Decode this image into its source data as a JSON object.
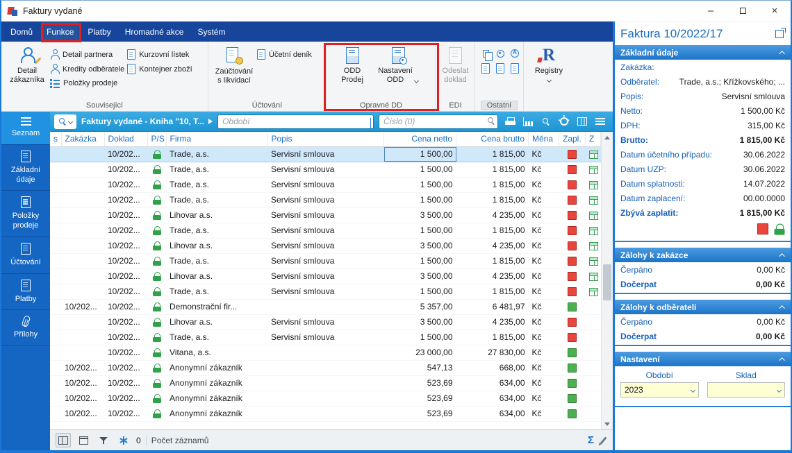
{
  "window": {
    "title": "Faktury vydané"
  },
  "icons": {
    "sum_glyph": "Σ",
    "registry_glyph": "R"
  },
  "ribbon": {
    "tabs": [
      {
        "id": "domu",
        "label": "Domů",
        "active": false
      },
      {
        "id": "funkce",
        "label": "Funkce",
        "active": true
      },
      {
        "id": "platby",
        "label": "Platby",
        "active": false
      },
      {
        "id": "hromadne-akce",
        "label": "Hromadné akce",
        "active": false
      },
      {
        "id": "system",
        "label": "Systém",
        "active": false
      }
    ],
    "detail_customer_label": "Detail\nzákazníka",
    "groups": {
      "related": {
        "title": "Související",
        "items": [
          {
            "id": "detail-partnera",
            "label": "Detail partnera",
            "icon": "person-card"
          },
          {
            "id": "kredity-odberatele",
            "label": "Kredity odběratele",
            "icon": "person-key"
          },
          {
            "id": "polozky-prodeje",
            "label": "Položky prodeje",
            "icon": "list"
          },
          {
            "id": "kurzovni-listek",
            "label": "Kurzovní lístek",
            "icon": "doc"
          },
          {
            "id": "kontejner-zbozi",
            "label": "Kontejner zboží",
            "icon": "doc"
          }
        ]
      },
      "accounting": {
        "title": "Účtování",
        "posting_label": "Zaúčtování\ns likvidací",
        "journal_label": "Účetní deník"
      },
      "corrective": {
        "title": "Opravné DD",
        "odd_sale_label": "ODD\nProdej",
        "odd_settings_label": "Nastavení\nODD"
      },
      "edi": {
        "title": "EDI",
        "send_label": "Odeslat\ndoklad"
      },
      "other": {
        "title": "Ostatní"
      },
      "registry": {
        "label": "Registry"
      }
    }
  },
  "sidebar": [
    {
      "id": "seznam",
      "label": "Seznam",
      "icon": "menu",
      "active": true
    },
    {
      "id": "zakladni-udaje",
      "label": "Základní údaje",
      "icon": "doc",
      "active": false
    },
    {
      "id": "polozky-prodeje",
      "label": "Položky prodeje",
      "icon": "doc",
      "active": false
    },
    {
      "id": "uctovani",
      "label": "Účtování",
      "icon": "doc",
      "active": false
    },
    {
      "id": "platby",
      "label": "Platby",
      "icon": "doc",
      "active": false
    },
    {
      "id": "prilohy",
      "label": "Přílohy",
      "icon": "clip",
      "active": false
    }
  ],
  "toolbar": {
    "book_label": "Faktury vydané - Kniha \"10, T...",
    "period_placeholder": "Období",
    "search_placeholder": "Číslo (0)"
  },
  "table": {
    "columns": [
      "s",
      "Zakázka",
      "Doklad",
      "P/S",
      "Firma",
      "Popis",
      "Cena netto",
      "Cena brutto",
      "Měna",
      "Zapl.",
      "Z"
    ],
    "rows": [
      {
        "zakazka": "",
        "doklad": "10/202...",
        "lock": true,
        "firma": "Trade, a.s.",
        "popis": "Servisní smlouva",
        "netto": "1 500,00",
        "brutto": "1 815,00",
        "mena": "Kč",
        "zapl": "red",
        "z": true,
        "selected": true
      },
      {
        "zakazka": "",
        "doklad": "10/202...",
        "lock": true,
        "firma": "Trade, a.s.",
        "popis": "Servisní smlouva",
        "netto": "1 500,00",
        "brutto": "1 815,00",
        "mena": "Kč",
        "zapl": "red",
        "z": true,
        "selected": false
      },
      {
        "zakazka": "",
        "doklad": "10/202...",
        "lock": true,
        "firma": "Trade, a.s.",
        "popis": "Servisní smlouva",
        "netto": "1 500,00",
        "brutto": "1 815,00",
        "mena": "Kč",
        "zapl": "red",
        "z": true,
        "selected": false
      },
      {
        "zakazka": "",
        "doklad": "10/202...",
        "lock": true,
        "firma": "Trade, a.s.",
        "popis": "Servisní smlouva",
        "netto": "1 500,00",
        "brutto": "1 815,00",
        "mena": "Kč",
        "zapl": "red",
        "z": true,
        "selected": false
      },
      {
        "zakazka": "",
        "doklad": "10/202...",
        "lock": true,
        "firma": "Lihovar a.s.",
        "popis": "Servisní smlouva",
        "netto": "3 500,00",
        "brutto": "4 235,00",
        "mena": "Kč",
        "zapl": "red",
        "z": true,
        "selected": false
      },
      {
        "zakazka": "",
        "doklad": "10/202...",
        "lock": true,
        "firma": "Trade, a.s.",
        "popis": "Servisní smlouva",
        "netto": "1 500,00",
        "brutto": "1 815,00",
        "mena": "Kč",
        "zapl": "red",
        "z": true,
        "selected": false
      },
      {
        "zakazka": "",
        "doklad": "10/202...",
        "lock": true,
        "firma": "Lihovar a.s.",
        "popis": "Servisní smlouva",
        "netto": "3 500,00",
        "brutto": "4 235,00",
        "mena": "Kč",
        "zapl": "red",
        "z": true,
        "selected": false
      },
      {
        "zakazka": "",
        "doklad": "10/202...",
        "lock": true,
        "firma": "Trade, a.s.",
        "popis": "Servisní smlouva",
        "netto": "1 500,00",
        "brutto": "1 815,00",
        "mena": "Kč",
        "zapl": "red",
        "z": true,
        "selected": false
      },
      {
        "zakazka": "",
        "doklad": "10/202...",
        "lock": true,
        "firma": "Lihovar a.s.",
        "popis": "Servisní smlouva",
        "netto": "3 500,00",
        "brutto": "4 235,00",
        "mena": "Kč",
        "zapl": "red",
        "z": true,
        "selected": false
      },
      {
        "zakazka": "",
        "doklad": "10/202...",
        "lock": true,
        "firma": "Trade, a.s.",
        "popis": "Servisní smlouva",
        "netto": "1 500,00",
        "brutto": "1 815,00",
        "mena": "Kč",
        "zapl": "red",
        "z": true,
        "selected": false
      },
      {
        "zakazka": "10/202...",
        "doklad": "10/202...",
        "lock": true,
        "firma": "Demonstrační fir...",
        "popis": "",
        "netto": "5 357,00",
        "brutto": "6 481,97",
        "mena": "Kč",
        "zapl": "green",
        "z": false,
        "selected": false
      },
      {
        "zakazka": "",
        "doklad": "10/202...",
        "lock": true,
        "firma": "Lihovar a.s.",
        "popis": "Servisní smlouva",
        "netto": "3 500,00",
        "brutto": "4 235,00",
        "mena": "Kč",
        "zapl": "red",
        "z": false,
        "selected": false
      },
      {
        "zakazka": "",
        "doklad": "10/202...",
        "lock": true,
        "firma": "Trade, a.s.",
        "popis": "Servisní smlouva",
        "netto": "1 500,00",
        "brutto": "1 815,00",
        "mena": "Kč",
        "zapl": "red",
        "z": false,
        "selected": false
      },
      {
        "zakazka": "",
        "doklad": "10/202...",
        "lock": true,
        "firma": "Vitana, a.s.",
        "popis": "",
        "netto": "23 000,00",
        "brutto": "27 830,00",
        "mena": "Kč",
        "zapl": "green",
        "z": false,
        "selected": false
      },
      {
        "zakazka": "10/202...",
        "doklad": "10/202...",
        "lock": true,
        "firma": "Anonymní zákazník",
        "popis": "",
        "netto": "547,13",
        "brutto": "668,00",
        "mena": "Kč",
        "zapl": "green",
        "z": false,
        "selected": false
      },
      {
        "zakazka": "10/202...",
        "doklad": "10/202...",
        "lock": true,
        "firma": "Anonymní zákazník",
        "popis": "",
        "netto": "523,69",
        "brutto": "634,00",
        "mena": "Kč",
        "zapl": "green",
        "z": false,
        "selected": false
      },
      {
        "zakazka": "10/202...",
        "doklad": "10/202...",
        "lock": true,
        "firma": "Anonymní zákazník",
        "popis": "",
        "netto": "523,69",
        "brutto": "634,00",
        "mena": "Kč",
        "zapl": "green",
        "z": false,
        "selected": false
      },
      {
        "zakazka": "10/202...",
        "doklad": "10/202...",
        "lock": true,
        "firma": "Anonymní zákazník",
        "popis": "",
        "netto": "523,69",
        "brutto": "634,00",
        "mena": "Kč",
        "zapl": "green",
        "z": false,
        "selected": false
      }
    ]
  },
  "statusbar": {
    "count": "0",
    "records_label": "Počet záznamů"
  },
  "detail": {
    "title": "Faktura 10/2022/17",
    "sections": [
      {
        "title": "Základní údaje",
        "fields": [
          {
            "label": "Zakázka:",
            "value": ""
          },
          {
            "label": "Odběratel:",
            "value": "Trade, a.s.; Křížkovského; ..."
          },
          {
            "label": "Popis:",
            "value": "Servisní smlouva"
          },
          {
            "label": "Netto:",
            "value": "1 500,00 Kč"
          },
          {
            "label": "DPH:",
            "value": "315,00 Kč"
          },
          {
            "label": "Brutto:",
            "value": "1 815,00 Kč",
            "bold": true
          },
          {
            "label": "Datum účetního případu:",
            "value": "30.06.2022"
          },
          {
            "label": "Datum UZP:",
            "value": "30.06.2022"
          },
          {
            "label": "Datum splatnosti:",
            "value": "14.07.2022"
          },
          {
            "label": "Datum zaplacení:",
            "value": "00.00.0000"
          },
          {
            "label": "Zbývá zaplatit:",
            "value": "1 815,00 Kč",
            "bold": true
          }
        ],
        "status_icons": [
          "unpaid-square",
          "locked-lock"
        ]
      },
      {
        "title": "Zálohy k zakázce",
        "fields": [
          {
            "label": "Čerpáno",
            "value": "0,00 Kč"
          },
          {
            "label": "Dočerpat",
            "value": "0,00 Kč",
            "bold": true
          }
        ]
      },
      {
        "title": "Zálohy k odběrateli",
        "fields": [
          {
            "label": "Čerpáno",
            "value": "0,00 Kč"
          },
          {
            "label": "Dočerpat",
            "value": "0,00 Kč",
            "bold": true
          }
        ]
      },
      {
        "title": "Nastavení",
        "combos": [
          {
            "id": "obdobi",
            "label": "Období",
            "value": "2023"
          },
          {
            "id": "sklad",
            "label": "Sklad",
            "value": ""
          }
        ]
      }
    ]
  },
  "colors": {
    "annotation_red": "#e0201f",
    "tabbar": "#17459c",
    "sidebar": "#1566c2",
    "sidebar_active": "#2191e2",
    "toolbar_top": "#3cabe3",
    "toolbar_bottom": "#1e95d4",
    "accent": "#1a79d8",
    "header_text": "#1a6fc4",
    "selected_row": "#cfe8fa",
    "paid_green": "#4cb050",
    "unpaid_red": "#e8453c",
    "combo_yellow": "#ffffd4",
    "section_top": "#4d9be0",
    "section_bottom": "#1c74c8",
    "label_blue": "#1560b8"
  }
}
